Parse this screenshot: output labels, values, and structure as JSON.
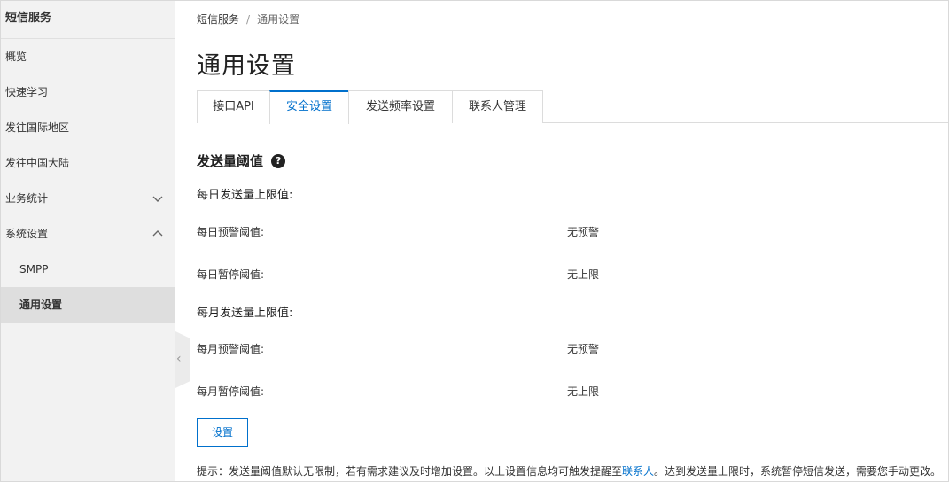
{
  "sidebar": {
    "title": "短信服务",
    "items": [
      {
        "label": "概览"
      },
      {
        "label": "快速学习"
      },
      {
        "label": "发往国际地区"
      },
      {
        "label": "发往中国大陆"
      },
      {
        "label": "业务统计"
      },
      {
        "label": "系统设置"
      },
      {
        "label": "SMPP"
      },
      {
        "label": "通用设置"
      }
    ],
    "collapse_glyph": "‹"
  },
  "breadcrumb": {
    "root": "短信服务",
    "separator": "/",
    "current": "通用设置"
  },
  "page_title": "通用设置",
  "tabs": [
    {
      "label": "接口API"
    },
    {
      "label": "安全设置"
    },
    {
      "label": "发送频率设置"
    },
    {
      "label": "联系人管理"
    }
  ],
  "active_tab": "安全设置",
  "section": {
    "title": "发送量阈值",
    "help_glyph": "?",
    "daily": {
      "label": "每日发送量上限值:",
      "warning_label": "每日预警阈值:",
      "warning_value": "无预警",
      "pause_label": "每日暂停阈值:",
      "pause_value": "无上限"
    },
    "monthly": {
      "label": "每月发送量上限值:",
      "warning_label": "每月预警阈值:",
      "warning_value": "无预警",
      "pause_label": "每月暂停阈值:",
      "pause_value": "无上限"
    }
  },
  "set_button": "设置",
  "tip": {
    "before": "提示：发送量阈值默认无限制，若有需求建议及时增加设置。以上设置信息均可触发提醒至",
    "link": "联系人",
    "after": "。达到发送量上限时，系统暂停短信发送，需要您手动更改。"
  },
  "colors": {
    "accent": "#0070cc",
    "sidebar_bg": "#f2f2f2",
    "sidebar_active_bg": "#dedede"
  }
}
